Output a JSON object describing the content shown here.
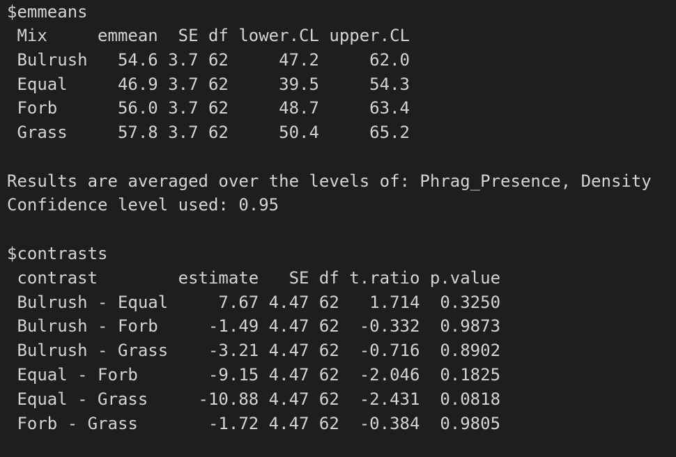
{
  "console": {
    "lines": [
      "$emmeans",
      " Mix     emmean  SE df lower.CL upper.CL",
      " Bulrush   54.6 3.7 62     47.2     62.0",
      " Equal     46.9 3.7 62     39.5     54.3",
      " Forb      56.0 3.7 62     48.7     63.4",
      " Grass     57.8 3.7 62     50.4     65.2",
      "",
      "Results are averaged over the levels of: Phrag_Presence, Density",
      "Confidence level used: 0.95",
      "",
      "$contrasts",
      " contrast        estimate   SE df t.ratio p.value",
      " Bulrush - Equal     7.67 4.47 62   1.714  0.3250",
      " Bulrush - Forb     -1.49 4.47 62  -0.332  0.9873",
      " Bulrush - Grass    -3.21 4.47 62  -0.716  0.8902",
      " Equal - Forb       -9.15 4.47 62  -2.046  0.1825",
      " Equal - Grass     -10.88 4.47 62  -2.431  0.0818",
      " Forb - Grass       -1.72 4.47 62  -0.384  0.9805"
    ]
  }
}
